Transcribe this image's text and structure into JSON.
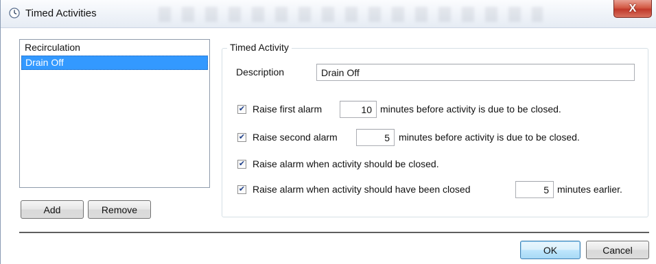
{
  "window": {
    "title": "Timed Activities",
    "close_label": "X"
  },
  "list": {
    "items": [
      {
        "label": "Recirculation",
        "selected": false
      },
      {
        "label": "Drain Off",
        "selected": true
      }
    ]
  },
  "list_buttons": {
    "add_label": "Add",
    "remove_label": "Remove"
  },
  "timed_activity": {
    "group_title": "Timed Activity",
    "description_label": "Description",
    "description_value": "Drain Off",
    "first_alarm": {
      "checked": true,
      "label_before": "Raise first alarm",
      "value": "10",
      "label_after": "minutes before activity is due to be closed."
    },
    "second_alarm": {
      "checked": true,
      "label_before": "Raise second alarm",
      "value": "5",
      "label_after": "minutes before activity is due to be closed."
    },
    "closed_alarm": {
      "checked": true,
      "label": "Raise alarm when activity should be closed."
    },
    "late_alarm": {
      "checked": true,
      "label_before": "Raise alarm when activity should have been closed",
      "value": "5",
      "label_after": "minutes earlier."
    }
  },
  "dialog_buttons": {
    "ok_label": "OK",
    "cancel_label": "Cancel"
  }
}
